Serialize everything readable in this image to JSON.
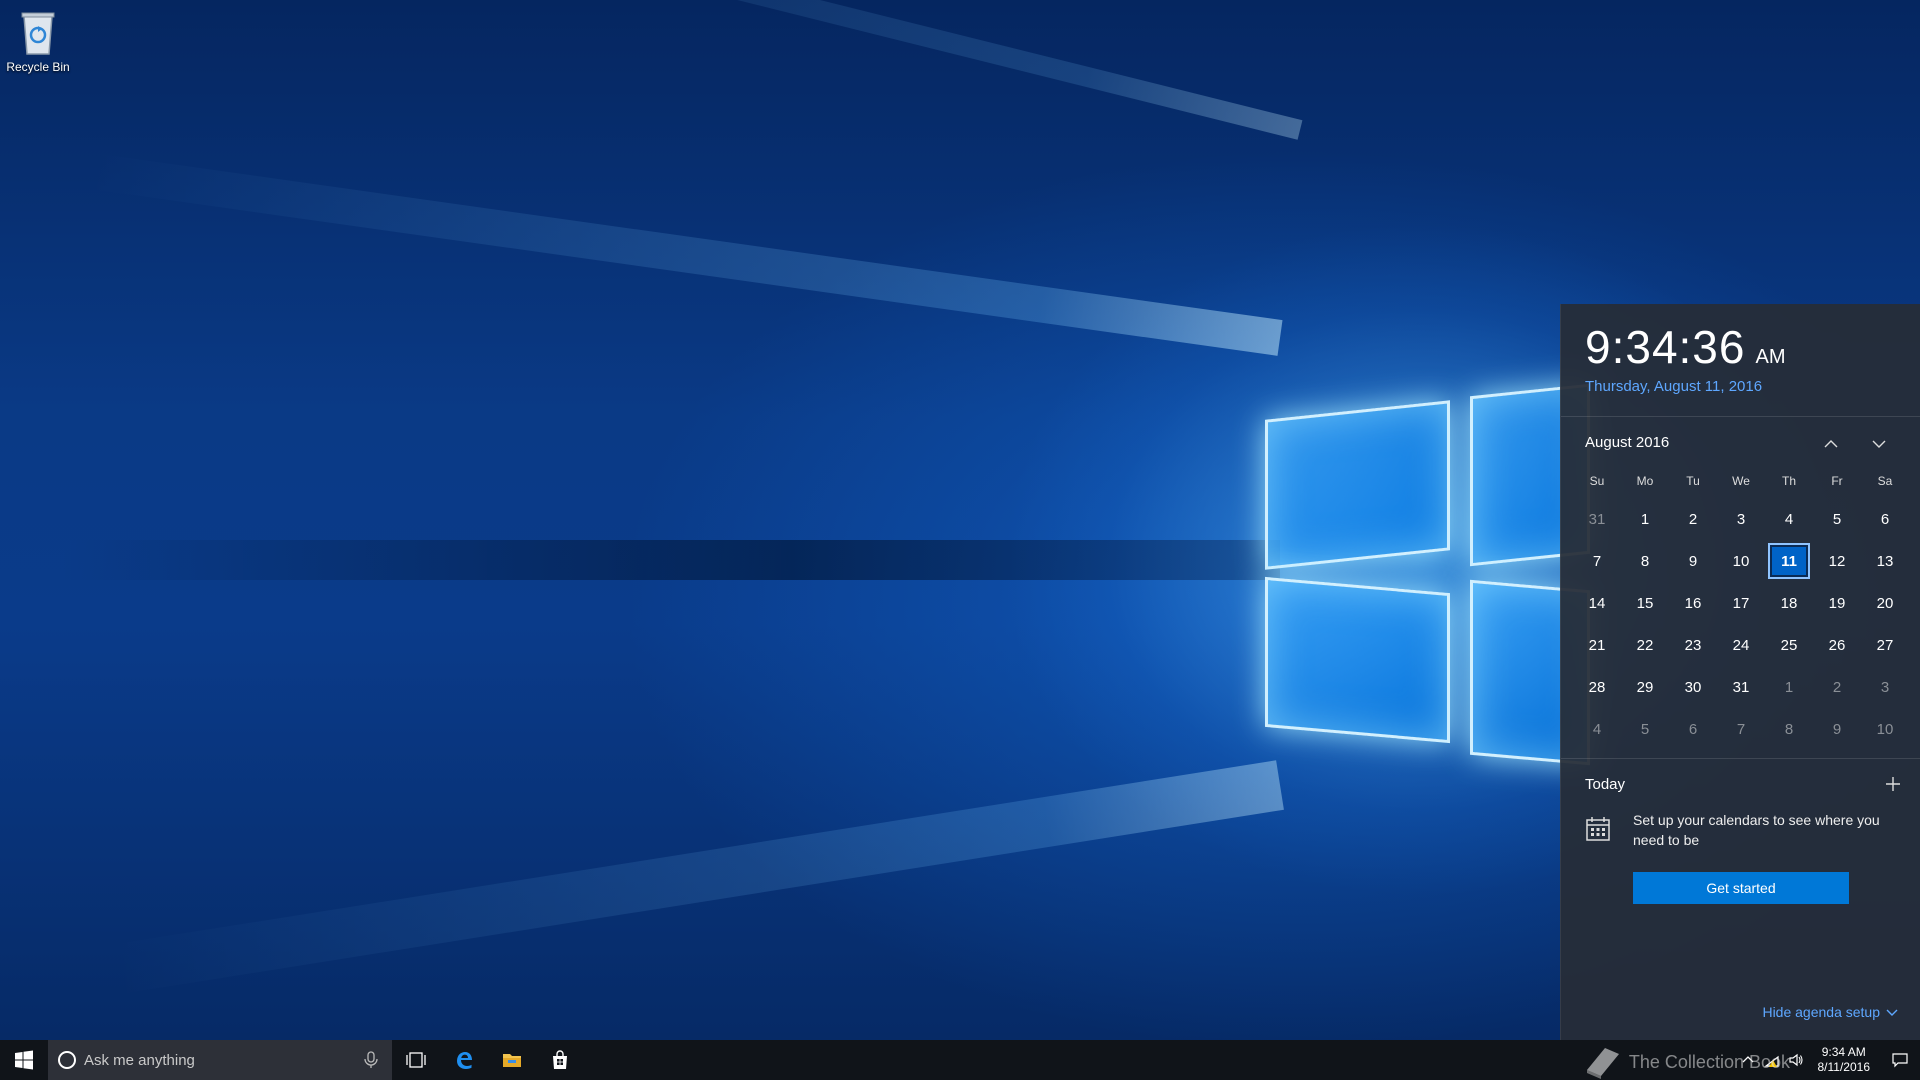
{
  "desktop": {
    "icons": [
      {
        "label": "Recycle Bin",
        "icon": "recycle-bin-icon"
      }
    ]
  },
  "calendar_flyout": {
    "time": "9:34:36",
    "ampm": "AM",
    "date_long": "Thursday, August 11, 2016",
    "month_label": "August 2016",
    "weekdays": [
      "Su",
      "Mo",
      "Tu",
      "We",
      "Th",
      "Fr",
      "Sa"
    ],
    "days": [
      {
        "d": "31",
        "cur": false
      },
      {
        "d": "1",
        "cur": true
      },
      {
        "d": "2",
        "cur": true
      },
      {
        "d": "3",
        "cur": true
      },
      {
        "d": "4",
        "cur": true
      },
      {
        "d": "5",
        "cur": true
      },
      {
        "d": "6",
        "cur": true
      },
      {
        "d": "7",
        "cur": true
      },
      {
        "d": "8",
        "cur": true
      },
      {
        "d": "9",
        "cur": true
      },
      {
        "d": "10",
        "cur": true
      },
      {
        "d": "11",
        "cur": true,
        "today": true
      },
      {
        "d": "12",
        "cur": true
      },
      {
        "d": "13",
        "cur": true
      },
      {
        "d": "14",
        "cur": true
      },
      {
        "d": "15",
        "cur": true
      },
      {
        "d": "16",
        "cur": true
      },
      {
        "d": "17",
        "cur": true
      },
      {
        "d": "18",
        "cur": true
      },
      {
        "d": "19",
        "cur": true
      },
      {
        "d": "20",
        "cur": true
      },
      {
        "d": "21",
        "cur": true
      },
      {
        "d": "22",
        "cur": true
      },
      {
        "d": "23",
        "cur": true
      },
      {
        "d": "24",
        "cur": true
      },
      {
        "d": "25",
        "cur": true
      },
      {
        "d": "26",
        "cur": true
      },
      {
        "d": "27",
        "cur": true
      },
      {
        "d": "28",
        "cur": true
      },
      {
        "d": "29",
        "cur": true
      },
      {
        "d": "30",
        "cur": true
      },
      {
        "d": "31",
        "cur": true
      },
      {
        "d": "1",
        "cur": false
      },
      {
        "d": "2",
        "cur": false
      },
      {
        "d": "3",
        "cur": false
      },
      {
        "d": "4",
        "cur": false
      },
      {
        "d": "5",
        "cur": false
      },
      {
        "d": "6",
        "cur": false
      },
      {
        "d": "7",
        "cur": false
      },
      {
        "d": "8",
        "cur": false
      },
      {
        "d": "9",
        "cur": false
      },
      {
        "d": "10",
        "cur": false
      }
    ],
    "agenda": {
      "title": "Today",
      "message": "Set up your calendars to see where you need to be",
      "button_label": "Get started",
      "hide_label": "Hide agenda setup"
    },
    "accent_color": "#0078d7",
    "link_color": "#5ea7ff"
  },
  "taskbar": {
    "search_placeholder": "Ask me anything",
    "pinned": [
      "task-view-icon",
      "edge-icon",
      "file-explorer-icon",
      "store-icon"
    ],
    "tray_time": "9:34 AM",
    "tray_date": "8/11/2016",
    "watermark_text": "The Collection Book"
  }
}
